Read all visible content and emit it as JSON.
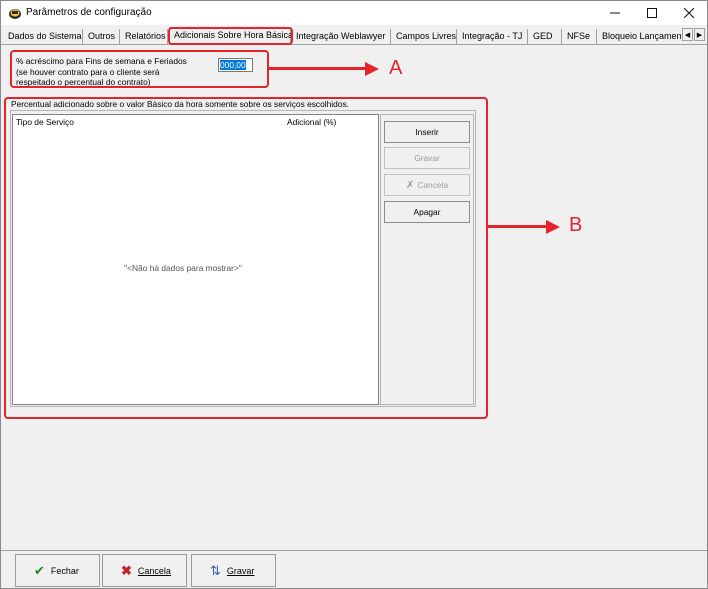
{
  "window": {
    "title": "Parâmetros de configuração",
    "accent": "#e3242b"
  },
  "tabs": [
    {
      "label": "Dados do Sistema"
    },
    {
      "label": "Outros"
    },
    {
      "label": "Relatórios"
    },
    {
      "label": "Adicionais Sobre Hora Básica",
      "active": true
    },
    {
      "label": "Integração Weblawyer"
    },
    {
      "label": "Campos Livres"
    },
    {
      "label": "Integração - TJ"
    },
    {
      "label": "GED"
    },
    {
      "label": "NFSe"
    },
    {
      "label": "Bloqueio Lançament"
    }
  ],
  "weekend": {
    "label_line1": "% acréscimo para Fins de semana e Feriados",
    "label_line2": "(se houver contrato para o cliente será",
    "label_line3": "respeitado o percentual do contrato)",
    "value": "000,00"
  },
  "services": {
    "group_title": "Percentual adicionado sobre o valor Básico da hora somente sobre os serviços escolhidos.",
    "columns": [
      "Tipo de Serviço",
      "Adicional (%)"
    ],
    "empty_message": "\"<Não há dados para mostrar>\"",
    "buttons": {
      "insert": "Inserir",
      "save": "Gravar",
      "cancel": "Cancela",
      "delete": "Apagar"
    }
  },
  "annotations": {
    "a": "A",
    "b": "B"
  },
  "footer": {
    "close": "Fechar",
    "cancel": "Cancela",
    "save": "Gravar"
  }
}
